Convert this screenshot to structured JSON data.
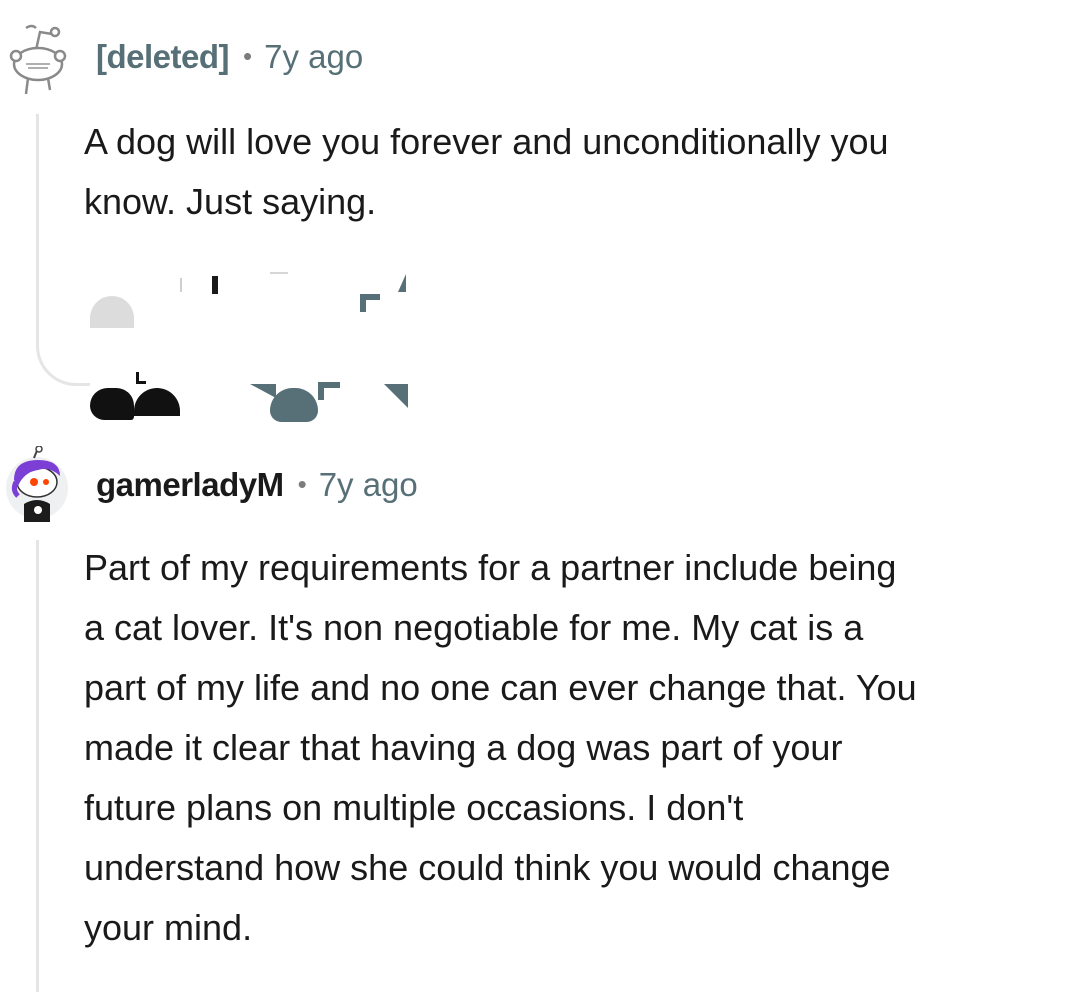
{
  "comments": [
    {
      "author": "[deleted]",
      "separator": "•",
      "age": "7y ago",
      "body": "A dog will love you forever and unconditionally you\nknow. Just saying."
    },
    {
      "author": "gamerladyM",
      "separator": "•",
      "age": "7y ago",
      "body": "Part of my requirements for a partner include being\na cat lover. It's non negotiable for me. My cat is a\npart of my life and no one can ever change that. You\nmade it clear that having a dog was part of your\nfuture plans on multiple occasions. I don't\nunderstand how she could think you would change\nyour mind."
    }
  ],
  "colors": {
    "background": "#ffffff",
    "text": "#1a1a1b",
    "meta": "#576f76",
    "thread_line": "#e5e5e5",
    "avatar_hair": "#7b3fd6"
  },
  "icons": {
    "deleted_avatar": "snoo-outline-icon",
    "user_avatar": "snoo-avatar-icon"
  }
}
